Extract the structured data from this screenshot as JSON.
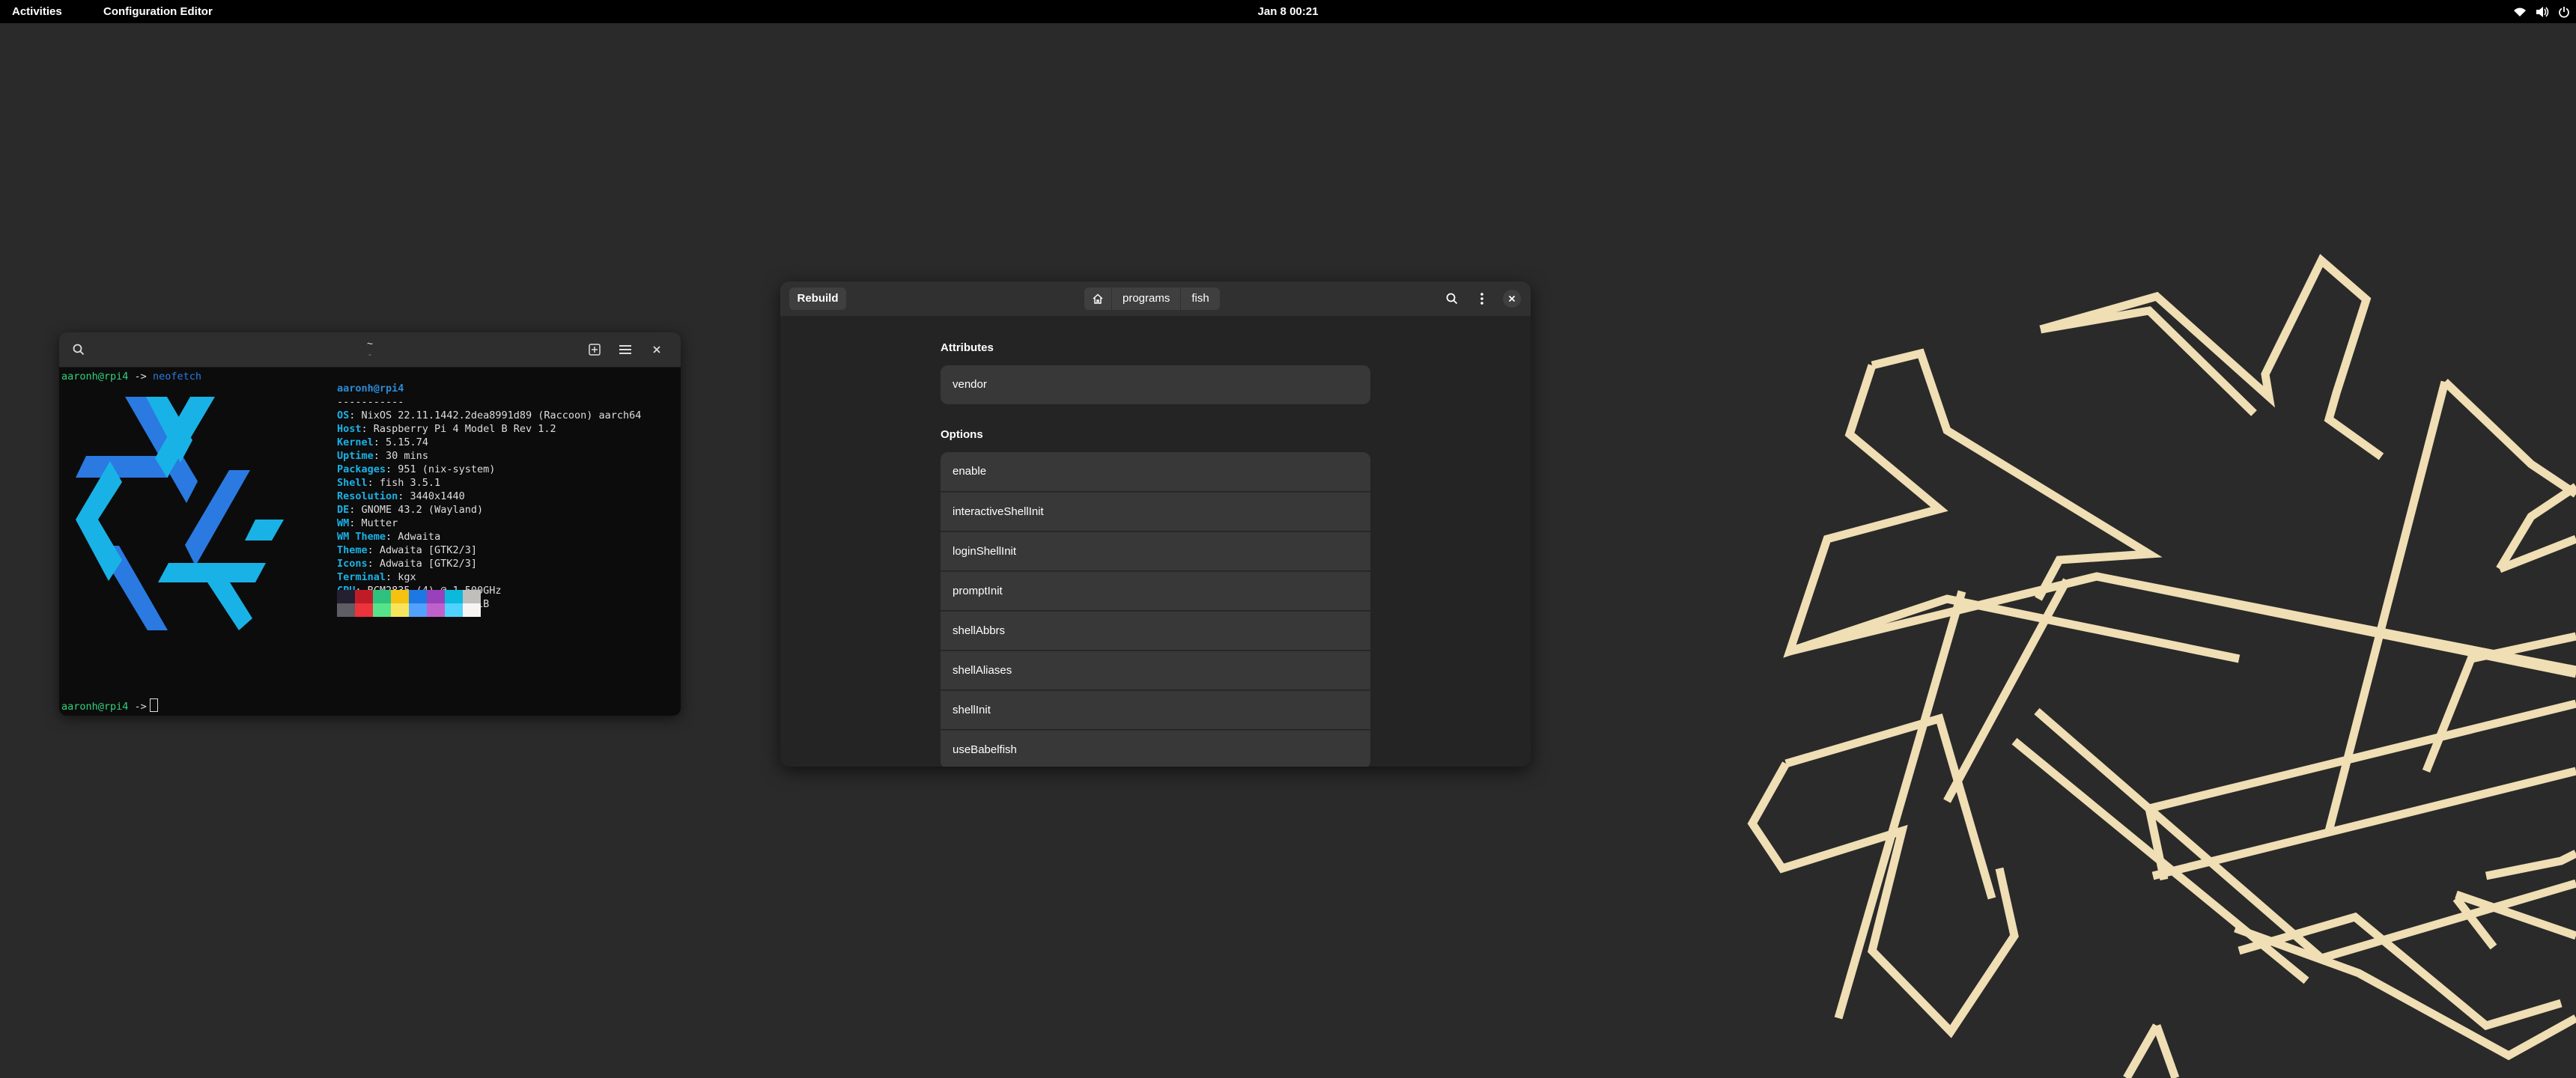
{
  "topbar": {
    "activities": "Activities",
    "app_name": "Configuration Editor",
    "clock": "Jan 8  00:21",
    "tray_icons": [
      "wifi-icon",
      "volume-icon",
      "power-icon"
    ]
  },
  "terminal": {
    "title": "~",
    "subtitle": "-",
    "prompt_user": "aaronh@rpi4",
    "prompt_arrow": "->",
    "command": "neofetch",
    "userhost": "aaronh@rpi4",
    "separator": "-----------",
    "info": [
      {
        "label": "OS",
        "value": "NixOS 22.11.1442.2dea8991d89 (Raccoon) aarch64"
      },
      {
        "label": "Host",
        "value": "Raspberry Pi 4 Model B Rev 1.2"
      },
      {
        "label": "Kernel",
        "value": "5.15.74"
      },
      {
        "label": "Uptime",
        "value": "30 mins"
      },
      {
        "label": "Packages",
        "value": "951 (nix-system)"
      },
      {
        "label": "Shell",
        "value": "fish 3.5.1"
      },
      {
        "label": "Resolution",
        "value": "3440x1440"
      },
      {
        "label": "DE",
        "value": "GNOME 43.2 (Wayland)"
      },
      {
        "label": "WM",
        "value": "Mutter"
      },
      {
        "label": "WM Theme",
        "value": "Adwaita"
      },
      {
        "label": "Theme",
        "value": "Adwaita [GTK2/3]"
      },
      {
        "label": "Icons",
        "value": "Adwaita [GTK2/3]"
      },
      {
        "label": "Terminal",
        "value": "kgx"
      },
      {
        "label": "CPU",
        "value": "BCM2835 (4) @ 1.500GHz"
      },
      {
        "label": "Memory",
        "value": "1828MiB / 3786MiB"
      }
    ],
    "palette_top": [
      "#241f31",
      "#c01c28",
      "#2ec27e",
      "#f5c211",
      "#1e78e4",
      "#9841bb",
      "#0ab9dc",
      "#c0bfbc"
    ],
    "palette_bottom": [
      "#5e5c64",
      "#ed333b",
      "#57e389",
      "#f8e45c",
      "#51a1ff",
      "#c061cb",
      "#4fd2fd",
      "#f6f5f4"
    ],
    "logo_colors": {
      "dark": "#2a7ae2",
      "light": "#19b2e6"
    }
  },
  "config": {
    "rebuild_label": "Rebuild",
    "breadcrumbs": [
      "programs",
      "fish"
    ],
    "attributes_title": "Attributes",
    "attributes": [
      "vendor"
    ],
    "options_title": "Options",
    "options": [
      "enable",
      "interactiveShellInit",
      "loginShellInit",
      "promptInit",
      "shellAbbrs",
      "shellAliases",
      "shellInit",
      "useBabelfish"
    ]
  },
  "wallpaper": {
    "background": "#2a2a2a",
    "line_color": "#f0deb4"
  }
}
